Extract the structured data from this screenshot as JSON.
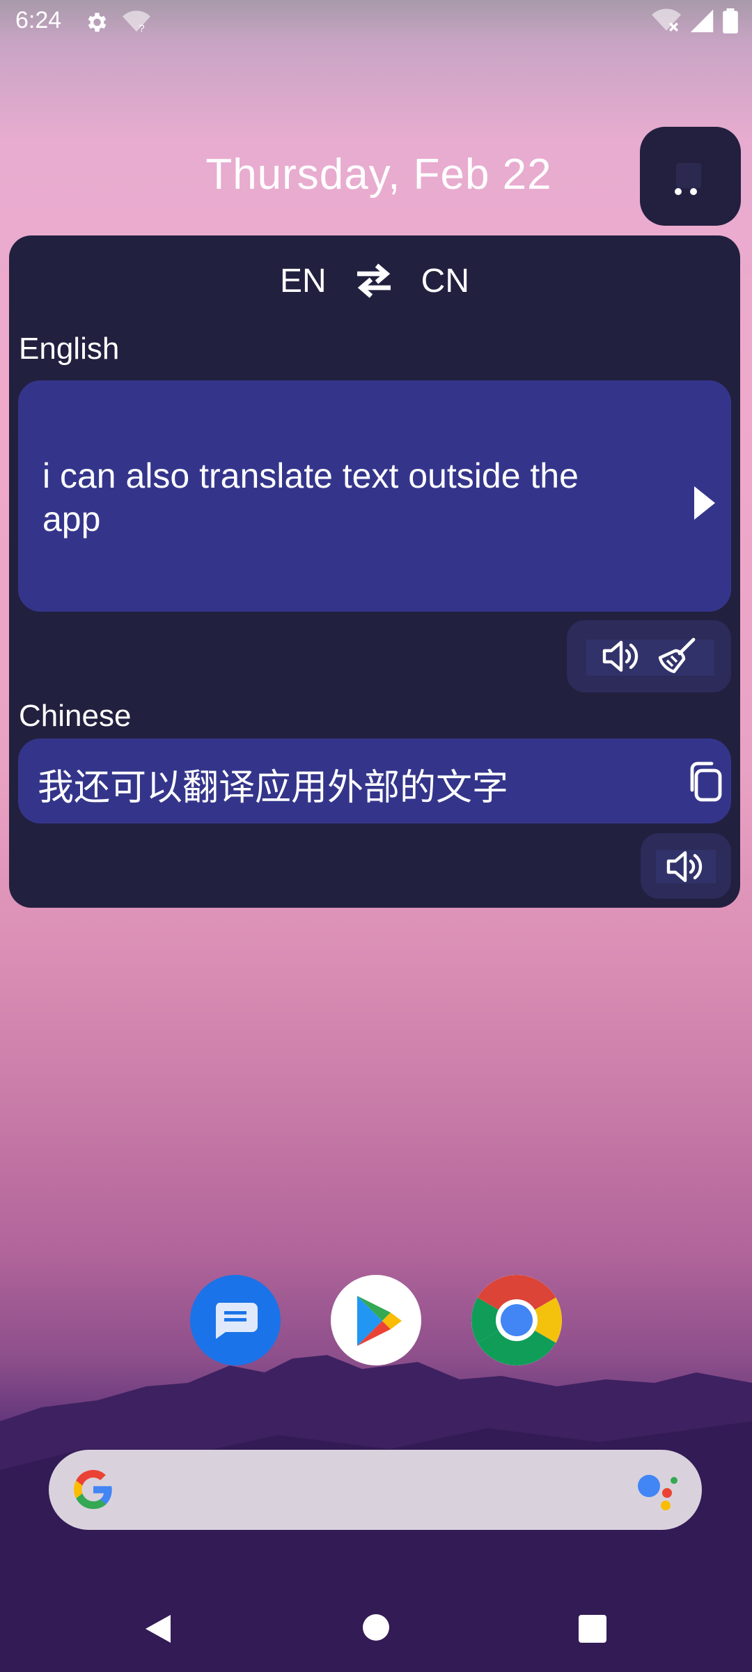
{
  "status_bar": {
    "time": "6:24"
  },
  "home": {
    "date": "Thursday, Feb 22"
  },
  "widget": {
    "source_lang_code": "EN",
    "target_lang_code": "CN",
    "source_label": "English",
    "input_text": "i can also translate text outside the app",
    "target_label": "Chinese",
    "output_text": "我还可以翻译应用外部的文字"
  },
  "dock": {
    "apps": [
      "Messages",
      "Play Store",
      "Chrome"
    ]
  },
  "colors": {
    "widget_bg": "#22203f",
    "card_bg": "#34358a",
    "accent": "#ffffff"
  }
}
